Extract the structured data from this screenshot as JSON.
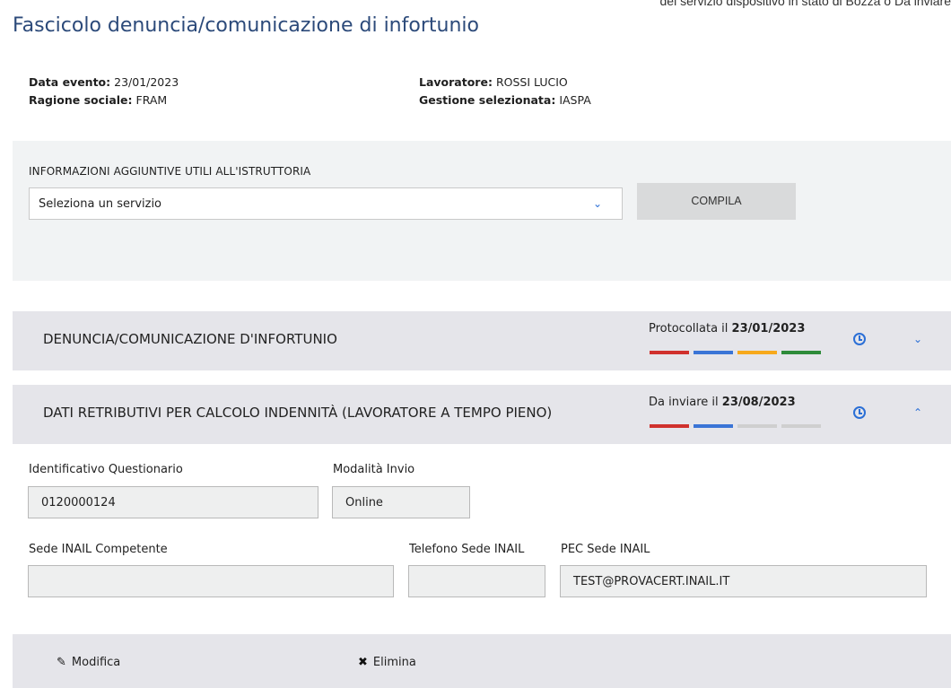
{
  "top_note": "del servizio dispositivo in stato di Bozza o Da inviare",
  "page_title": "Fascicolo denuncia/comunicazione di infortunio",
  "info": {
    "data_evento_label": "Data evento:",
    "data_evento_value": "23/01/2023",
    "ragione_label": "Ragione sociale:",
    "ragione_value": "FRAM",
    "lavoratore_label": "Lavoratore:",
    "lavoratore_value": "ROSSI LUCIO",
    "gestione_label": "Gestione selezionata:",
    "gestione_value": "IASPA"
  },
  "extra": {
    "label": "INFORMAZIONI AGGIUNTIVE UTILI ALL'ISTRUTTORIA",
    "select_value": "Seleziona un servizio",
    "compila_label": "COMPILA"
  },
  "accordions": [
    {
      "title": "DENUNCIA/COMUNICAZIONE D'INFORTUNIO",
      "status_text": "Protocollata il ",
      "status_date": "23/01/2023",
      "bars": [
        "#d0312d",
        "#3a74d6",
        "#f7a91c",
        "#2e8b3a"
      ],
      "chevron": "chevron-down"
    },
    {
      "title": "DATI RETRIBUTIVI PER CALCOLO INDENNITÀ (LAVORATORE A TEMPO PIENO)",
      "status_text": "Da inviare il ",
      "status_date": "23/08/2023",
      "bars": [
        "#d0312d",
        "#3a74d6",
        "#cfcfcf",
        "#cfcfcf"
      ],
      "chevron": "chevron-up"
    }
  ],
  "form": {
    "id_questionario_label": "Identificativo Questionario",
    "id_questionario_value": "0120000124",
    "modalita_label": "Modalità Invio",
    "modalita_value": "Online",
    "sede_label": "Sede INAIL Competente",
    "sede_value": "",
    "telefono_label": "Telefono Sede INAIL",
    "telefono_value": "",
    "pec_label": "PEC Sede INAIL",
    "pec_value": "TEST@PROVACERT.INAIL.IT"
  },
  "footer": {
    "modifica_label": "Modifica",
    "elimina_label": "Elimina"
  }
}
